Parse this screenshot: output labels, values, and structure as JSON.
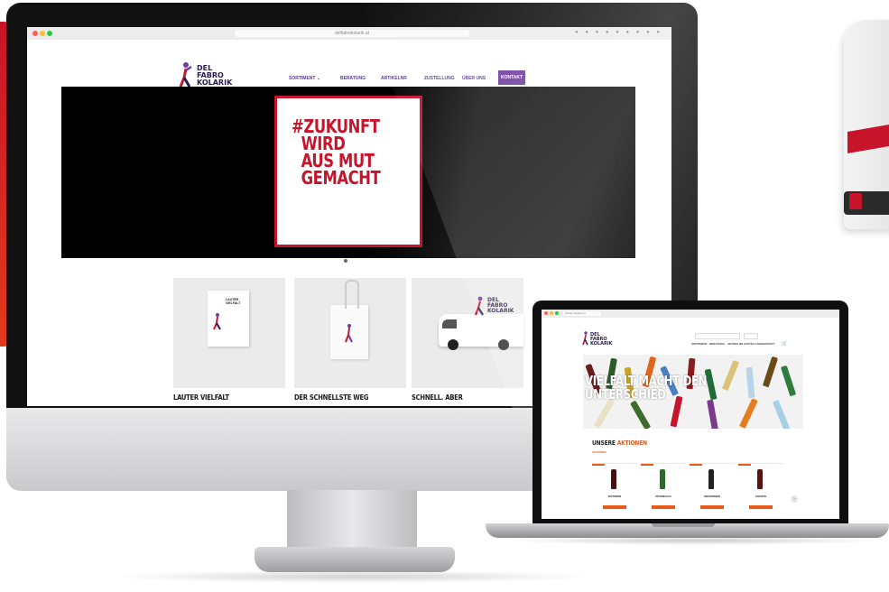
{
  "imac": {
    "site": {
      "url": "delfabrokolarik.at",
      "logo": {
        "line1": "DEL",
        "line2": "FABRO",
        "line3": "KOLARIK"
      },
      "nav": [
        {
          "label": "SORTIMENT ⌄"
        },
        {
          "label": "BERATUNG"
        },
        {
          "label": "ARTIKELNR"
        },
        {
          "label": "ZUSTELLUNG"
        },
        {
          "label": "ÜBER UNS"
        }
      ],
      "nav_button": "KONTAKT",
      "hero": {
        "text": "#ZUKUNFT\n  WIRD\n  AUS MUT\n  GEMACHT"
      },
      "tiles": [
        {
          "title": "LAUTER VIELFALT",
          "book_text": "LAUTER VIELFALT"
        },
        {
          "title": "DER SCHNELLSTE WEG"
        },
        {
          "title": "SCHNELL. ABER"
        }
      ]
    }
  },
  "laptop": {
    "site": {
      "url": "delfabrokolarik.at",
      "logo": {
        "line1": "DEL",
        "line2": "FABRO",
        "line3": "KOLARIK"
      },
      "nav": [
        "SORTIMENT",
        "BERATUNG",
        "ARTIKELNR",
        "ZUSTELLUNG",
        "KONTAKT"
      ],
      "hero_text": "VIELFALT MACHT DEN\nUNTERSCHIED",
      "section": {
        "title_part1": "UNSERE ",
        "title_part2": "AKTIONEN",
        "subtitle": "AKTIONEN"
      },
      "products": [
        {
          "name": "ROTWEIN"
        },
        {
          "name": "PROSECCO"
        },
        {
          "name": "WEISSWEIN"
        },
        {
          "name": "CHIANTI"
        }
      ],
      "scroll_label": "›"
    }
  },
  "colors": {
    "brand_red": "#c8142a",
    "brand_purple": "#6f3d9e",
    "accent_orange": "#e85a1a"
  }
}
